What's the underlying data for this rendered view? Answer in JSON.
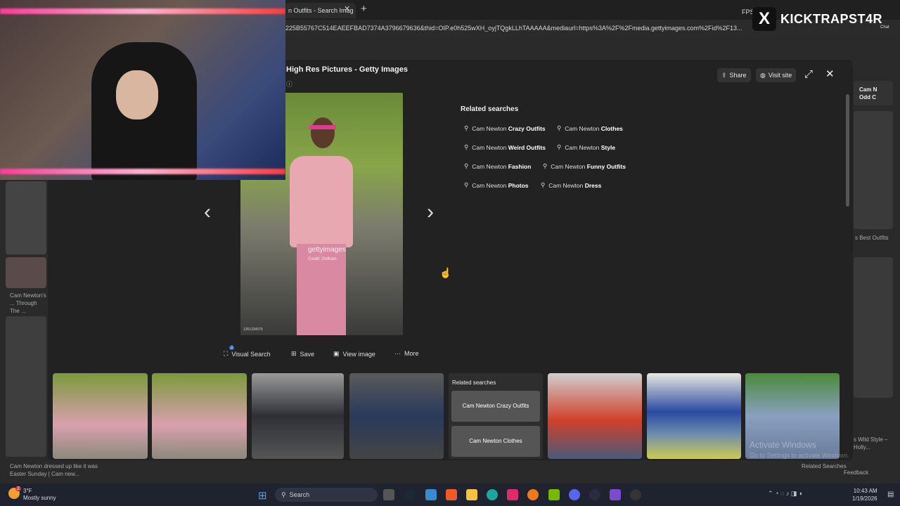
{
  "browser": {
    "tab_title": "n Outfits - Search Imag",
    "tab_close": "✕",
    "new_tab": "+",
    "fps_label": "FPS",
    "url": "225B55767C514EAEEFBAD7374A3796679636&thid=OIP.e0h525wXH_oyjTQgkLLhTAAAAA&mediaurl=https%3A%2F%2Fmedia.gettyimages.com%2Fid%2F13..."
  },
  "viewer": {
    "title": "High Res Pictures - Getty Images",
    "info_icon": "ⓘ",
    "share_label": "Share",
    "visit_label": "Visit site",
    "image": {
      "watermark": "gettyimages",
      "credit": "Credit: Gotham",
      "id": "1351334075"
    },
    "related_heading": "Related searches",
    "related": [
      {
        "prefix": "Cam Newton ",
        "bold": "Crazy Outfits"
      },
      {
        "prefix": "Cam Newton ",
        "bold": "Clothes"
      },
      {
        "prefix": "Cam Newton ",
        "bold": "Weird Outfits"
      },
      {
        "prefix": "Cam Newton ",
        "bold": "Style"
      },
      {
        "prefix": "Cam Newton ",
        "bold": "Fashion"
      },
      {
        "prefix": "Cam Newton ",
        "bold": "Funny Outfits"
      },
      {
        "prefix": "Cam Newton ",
        "bold": "Photos"
      },
      {
        "prefix": "Cam Newton ",
        "bold": "Dress"
      }
    ],
    "actions": {
      "visual_search": "Visual Search",
      "visual_badge": "2",
      "save": "Save",
      "view_image": "View image",
      "more": "More"
    },
    "strip_related": {
      "heading": "Related searches",
      "item1": "Cam Newton Crazy Outfits",
      "item2": "Cam Newton Clothes"
    }
  },
  "background": {
    "left_caption": "Cam Newton's ... Through The ...",
    "bottom_caption": "Cam Newton dressed up like it was Easter Sunday | Cam new...",
    "right_card1": "Cam N Odd C",
    "right_caption1": "s Best Outfits",
    "right_caption2": "s Wild Style – Holly...",
    "right_related": "Related Searches"
  },
  "stream": {
    "badge_logo": "X",
    "badge_name": "KICKTRAPST4R",
    "chat_label": "Chat"
  },
  "windows": {
    "activate": "Activate Windows",
    "activate_sub": "Go to Settings to activate Windows.",
    "feedback": "Feedback"
  },
  "taskbar": {
    "weather_badge": "2",
    "temp": "3°F",
    "weather": "Mostly sunny",
    "search_placeholder": "Search",
    "time": "10:43 AM",
    "date": "1/19/2026"
  }
}
